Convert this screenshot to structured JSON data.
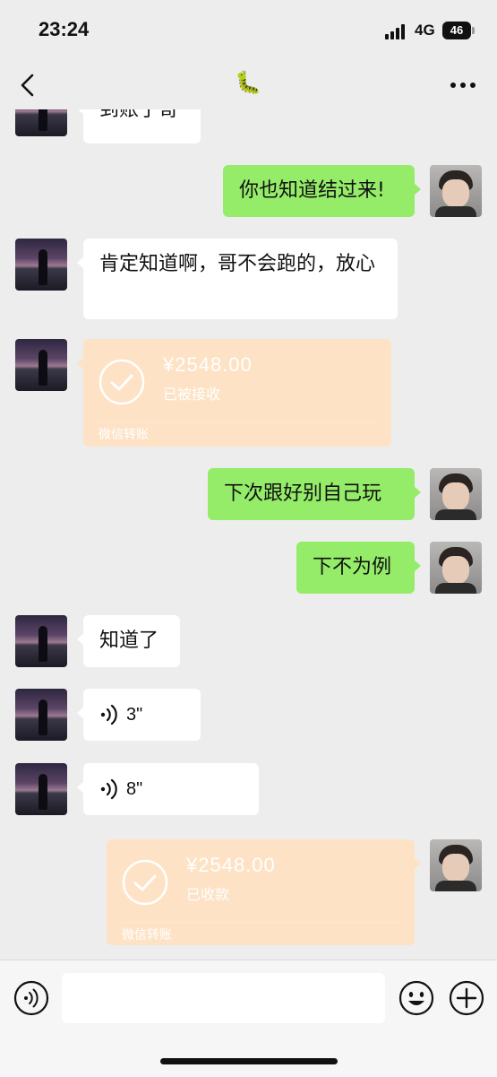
{
  "status_bar": {
    "time": "23:24",
    "network": "4G",
    "battery": "46"
  },
  "nav": {
    "title_icon": "🐛",
    "back_icon": "chevron-left-icon",
    "more_icon": "more-dots-icon"
  },
  "messages": [
    {
      "side": "left",
      "type": "text",
      "text": "到账了哥"
    },
    {
      "side": "right",
      "type": "text",
      "text": "你也知道结过来!"
    },
    {
      "side": "left",
      "type": "text",
      "text": "肯定知道啊，哥不会跑的，放心"
    },
    {
      "side": "left",
      "type": "transfer",
      "amount": "¥2548.00",
      "status": "已被接收",
      "footer": "微信转账"
    },
    {
      "side": "right",
      "type": "text",
      "text": "下次跟好别自己玩"
    },
    {
      "side": "right",
      "type": "text",
      "text": "下不为例"
    },
    {
      "side": "left",
      "type": "text",
      "text": "知道了"
    },
    {
      "side": "left",
      "type": "voice",
      "duration": "3\""
    },
    {
      "side": "left",
      "type": "voice",
      "duration": "8\""
    },
    {
      "side": "right",
      "type": "transfer",
      "amount": "¥2548.00",
      "status": "已收款",
      "footer": "微信转账"
    }
  ],
  "input_bar": {
    "voice_icon": "voice-toggle-icon",
    "emoji_icon": "emoji-icon",
    "plus_icon": "plus-icon"
  },
  "colors": {
    "background": "#ededed",
    "bubble_green": "#95ec69",
    "bubble_white": "#ffffff",
    "transfer_bg": "#fde2c5"
  }
}
